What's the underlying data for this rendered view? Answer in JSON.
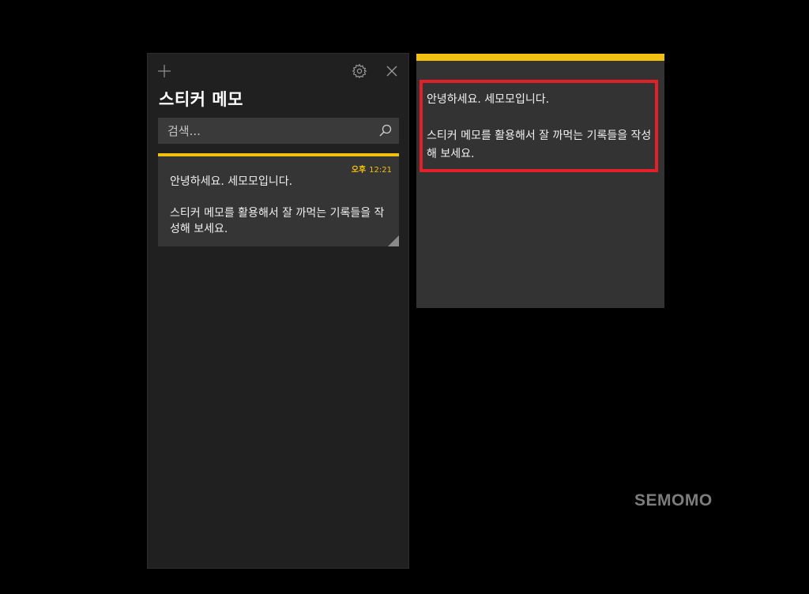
{
  "list_panel": {
    "toolbar": {
      "add_icon": "plus-icon",
      "settings_icon": "gear-icon",
      "close_icon": "close-icon"
    },
    "title": "스티커 메모",
    "search": {
      "placeholder": "검색...",
      "value": "",
      "icon": "search-icon"
    },
    "notes": [
      {
        "ampm": "오후",
        "time": "12:21",
        "text": "안녕하세요. 세모모입니다.\n\n스티커 메모를 활용해서 잘 까먹는 기록들을 작성해 보세요."
      }
    ]
  },
  "note_window": {
    "text": "안녕하세요. 세모모입니다.\n\n스티커 메모를 활용해서 잘 까먹는 기록들을 작성해 보세요."
  },
  "colors": {
    "accent": "#f2c00f",
    "highlight": "#e3202a",
    "panel_bg": "#202020",
    "card_bg": "#353535",
    "note_bg": "#333333"
  },
  "watermark": "SEMOMO"
}
